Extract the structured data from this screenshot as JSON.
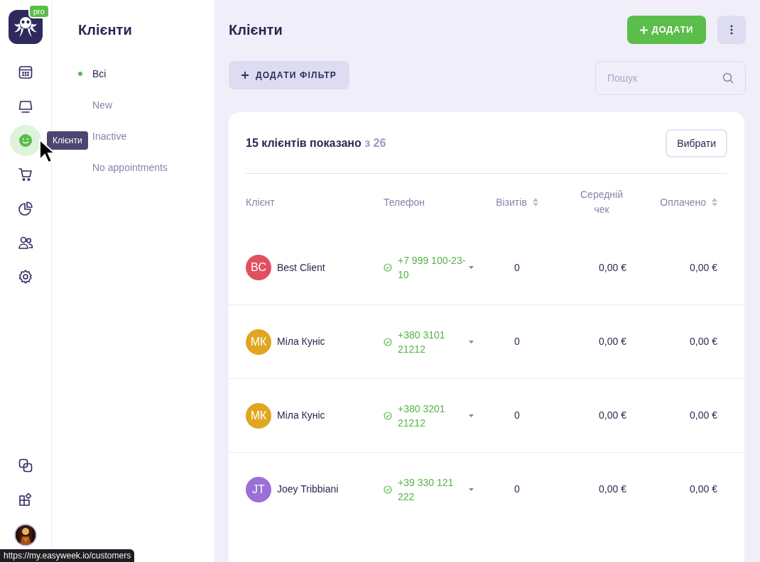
{
  "rail": {
    "items": [
      {
        "selected": false
      },
      {
        "selected": false
      },
      {
        "selected": true
      },
      {
        "selected": false
      },
      {
        "selected": false
      },
      {
        "selected": false
      },
      {
        "selected": false
      }
    ],
    "bottom_items": [
      {
        "selected": false
      },
      {
        "selected": false
      }
    ],
    "badge": "pro",
    "tooltip": "Клієнти"
  },
  "subnav": {
    "title": "Клієнти",
    "items": [
      {
        "label": "Всі",
        "selected": true
      },
      {
        "label": "New",
        "selected": false
      },
      {
        "label": "Inactive",
        "selected": false
      },
      {
        "label": "No appointments",
        "selected": false
      }
    ]
  },
  "header": {
    "title": "Клієнти",
    "add_button": "ДОДАТИ",
    "filter_button": "ДОДАТИ ФІЛЬТР",
    "search": {
      "placeholder": "Пошук"
    }
  },
  "card": {
    "shown": "15 клієнтів показано",
    "total": "з 26",
    "select_button": "Вибрати"
  },
  "table": {
    "columns": [
      {
        "label": "Клієнт",
        "sortable": false
      },
      {
        "label": "Телефон",
        "sortable": false
      },
      {
        "label": "Візитів",
        "sortable": true
      },
      {
        "label": "Середній чек",
        "sortable": false
      },
      {
        "label": "Оплачено",
        "sortable": true
      }
    ],
    "rows": [
      {
        "initials": "BC",
        "color": "#e2505f",
        "name": "Best Client",
        "phone": "+7 999 100-23-10",
        "visits": "0",
        "avg": "0,00 €",
        "paid": "0,00 €"
      },
      {
        "initials": "МК",
        "color": "#e0a61f",
        "name": "Міла Куніс",
        "phone": "+380 3101 21212",
        "visits": "0",
        "avg": "0,00 €",
        "paid": "0,00 €"
      },
      {
        "initials": "МК",
        "color": "#e0a61f",
        "name": "Міла Куніс",
        "phone": "+380 3201 21212",
        "visits": "0",
        "avg": "0,00 €",
        "paid": "0,00 €"
      },
      {
        "initials": "JT",
        "color": "#9a6fd6",
        "name": "Joey Tribbiani",
        "phone": "+39 330 121 222",
        "visits": "0",
        "avg": "0,00 €",
        "paid": "0,00 €"
      }
    ]
  },
  "status_bar": {
    "url": "https://my.easyweek.io/customers"
  }
}
